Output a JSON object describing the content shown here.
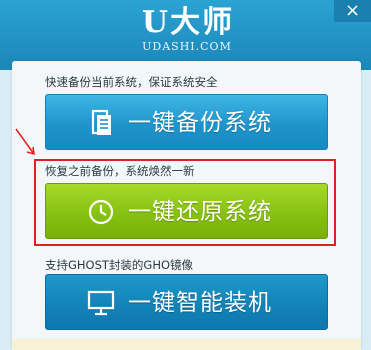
{
  "header": {
    "logo_text": "U大师",
    "logo_sub": "UDASHI.COM",
    "close_label": "×"
  },
  "actions": [
    {
      "caption": "快速备份当前系统，保证系统安全",
      "label": "一键备份系统",
      "icon": "document-icon"
    },
    {
      "caption": "恢复之前备份，系统焕然一新",
      "label": "一键还原系统",
      "icon": "clock-icon"
    },
    {
      "caption": "支持GHOST封装的GHO镜像",
      "label": "一键智能装机",
      "icon": "monitor-icon"
    }
  ],
  "colors": {
    "header_blue": "#1f8fbf",
    "backup_blue": "#2aa3d8",
    "restore_green": "#8cc414",
    "install_blue": "#1283b8",
    "highlight_red": "#e02020"
  }
}
